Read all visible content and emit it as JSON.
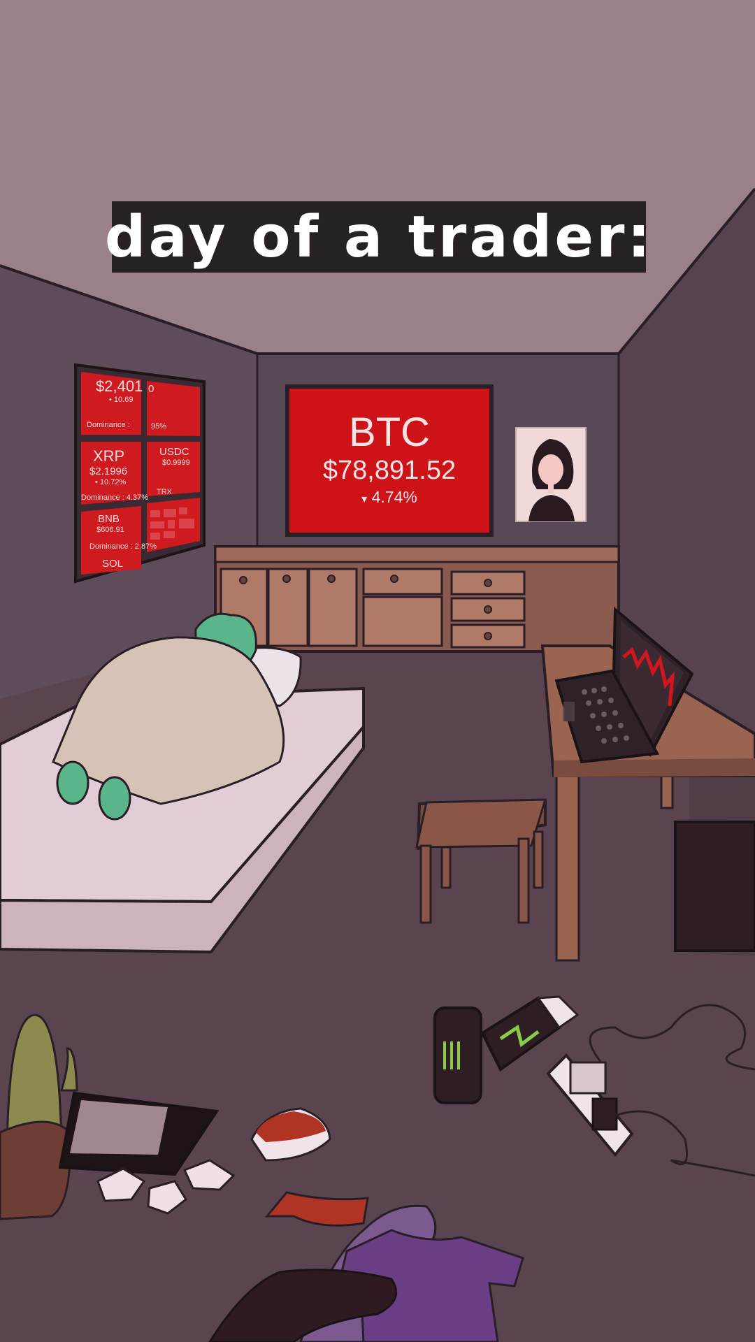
{
  "caption": {
    "text": "day of a trader:"
  },
  "tv": {
    "symbol": "BTC",
    "price": "$78,891.52",
    "change_arrow": "▾",
    "change": "4.74%"
  },
  "wall_monitors": {
    "tl_price": "$2,401",
    "tl_change": "• 10.69",
    "tl_extra": "0",
    "dominance_a": "Dominance :",
    "dominance_a_value": "95%",
    "xrp_name": "XRP",
    "xrp_price": "$2.1996",
    "xrp_change": "• 10.72%",
    "xrp_dominance": "Dominance : 4.37%",
    "usdc_name": "USDC",
    "usdc_price": "$0.9999",
    "trx_name": "TRX",
    "bnb_name": "BNB",
    "bnb_price": "$606.91",
    "bnb_dominance": "Dominance : 2.87%",
    "sol_name": "SOL"
  },
  "colors": {
    "ceiling": "#9a8088",
    "wall": "#5b4a57",
    "floor": "#5a4450",
    "screen_red": "#cd1218",
    "caption_bg": "#262224"
  }
}
